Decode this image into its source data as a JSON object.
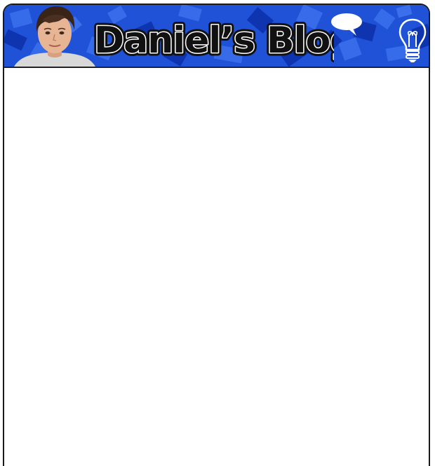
{
  "header": {
    "title": "Daniel’s Blog",
    "avatar_icon": "person-photo",
    "speech_bubble_icon": "speech-bubble-icon",
    "idea_icon": "lightbulb-icon"
  },
  "colors": {
    "banner_blue": "#1f52d6",
    "banner_dark": "#0e2fa8",
    "banner_light": "#3f74f0",
    "title_fill": "#ffffff",
    "title_stroke": "#111111",
    "frame_border": "#1a1a1a"
  },
  "main": {
    "content": ""
  }
}
